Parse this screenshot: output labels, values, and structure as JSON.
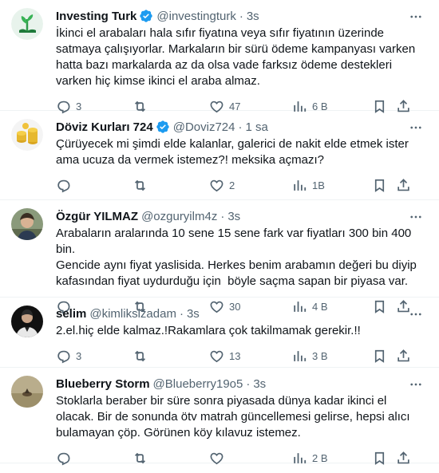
{
  "colors": {
    "text": "#0f1419",
    "muted": "#536471",
    "verified": "#1d9bf0",
    "divider": "#eff3f4"
  },
  "tweets": [
    {
      "name": "Investing Turk",
      "verified": true,
      "handle": "@investingturk",
      "dot": "·",
      "time": "3s",
      "text": "İkinci el arabaları hala sıfır fiyatına veya sıfır fiyatının üzerinde satmaya çalışıyorlar. Markaların bir sürü ödeme kampanyası varken hatta bazı markalarda az da olsa vade farksız ödeme destekleri varken hiç kimse ikinci el araba almaz.",
      "replies": "3",
      "retweets": "",
      "likes": "47",
      "views": "6 B"
    },
    {
      "name": "Döviz Kurları 724",
      "verified": true,
      "handle": "@Doviz724",
      "dot": "·",
      "time": "1 sa",
      "text": "Çürüyecek mi şimdi elde kalanlar, galerici de nakit elde etmek ister ama ucuza da vermek istemez?! meksika açmazı?",
      "replies": "",
      "retweets": "",
      "likes": "2",
      "views": "1B"
    },
    {
      "name": "Özgür YILMAZ",
      "verified": false,
      "handle": "@ozguryilm4z",
      "dot": "·",
      "time": "3s",
      "text": "Arabaların aralarında 10 sene 15 sene fark var fiyatları 300 bin 400 bin.\nGencide aynı fiyat yaslisida. Herkes benim arabamın değeri bu diyip kafasından fiyat uydurduğu için  böyle saçma sapan bir piyasa var.",
      "replies": "",
      "retweets": "",
      "likes": "30",
      "views": "4 B"
    },
    {
      "name": "selim",
      "verified": false,
      "handle": "@kimliksizadam",
      "dot": "·",
      "time": "3s",
      "text": "2.el.hiç elde kalmaz.!Rakamlara çok takilmamak gerekir.!!",
      "replies": "3",
      "retweets": "",
      "likes": "13",
      "views": "3 B"
    },
    {
      "name": "Blueberry Storm",
      "verified": false,
      "handle": "@Blueberry19o5",
      "dot": "·",
      "time": "3s",
      "text": "Stoklarla beraber bir süre sonra piyasada dünya kadar ikinci el olacak. Bir de sonunda ötv matrah güncellemesi gelirse, hepsi alıcı bulamayan çöp. Görünen köy kılavuz istemez.",
      "replies": "",
      "retweets": "",
      "likes": "",
      "views": "2 B"
    }
  ]
}
